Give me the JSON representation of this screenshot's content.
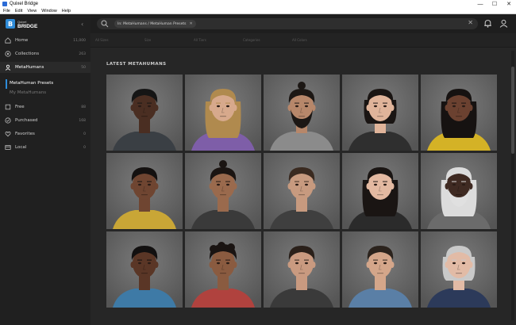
{
  "window": {
    "title": "Quixel Bridge",
    "menu": [
      "File",
      "Edit",
      "View",
      "Window",
      "Help"
    ]
  },
  "sidebar": {
    "logo_top": "Quixel",
    "logo_bottom": "BRIDGE",
    "items": [
      {
        "label": "Home",
        "count": "11,000",
        "icon": "home-icon"
      },
      {
        "label": "Collections",
        "count": "263",
        "icon": "collections-icon"
      },
      {
        "label": "MetaHumans",
        "count": "50",
        "icon": "metahumans-icon"
      },
      {
        "label": "Free",
        "count": "88",
        "icon": "free-icon"
      },
      {
        "label": "Purchased",
        "count": "168",
        "icon": "purchased-icon"
      },
      {
        "label": "Favorites",
        "count": "0",
        "icon": "favorites-icon"
      },
      {
        "label": "Local",
        "count": "0",
        "icon": "local-icon"
      }
    ],
    "sub_items": [
      "MetaHuman Presets",
      "My MetaHumans"
    ]
  },
  "search": {
    "chip": "In: MetaHumans / MetaHuman Presets"
  },
  "filters": [
    "All Sizes",
    "Size",
    "All Tiers",
    "Categories",
    "All Colors"
  ],
  "section_title": "LATEST METAHUMANS",
  "metahumans": [
    {
      "skin": "#4a2e22",
      "hair": "#151515",
      "shirt": "#3a3f44",
      "hairStyle": "short"
    },
    {
      "skin": "#d7a98c",
      "hair": "#b08a4e",
      "shirt": "#7e5ea8",
      "hairStyle": "long"
    },
    {
      "skin": "#b7876a",
      "hair": "#1c1714",
      "shirt": "#8b8b8b",
      "hairStyle": "bun",
      "beard": true
    },
    {
      "skin": "#e0b49a",
      "hair": "#1a1513",
      "shirt": "#2f2f2f",
      "hairStyle": "bob"
    },
    {
      "skin": "#6b4130",
      "hair": "#161211",
      "shirt": "#d4b226",
      "hairStyle": "long"
    },
    {
      "skin": "#6f4531",
      "hair": "#141110",
      "shirt": "#c9a636",
      "hairStyle": "short"
    },
    {
      "skin": "#9a6a4d",
      "hair": "#1b1512",
      "shirt": "#3a3a3a",
      "hairStyle": "bun"
    },
    {
      "skin": "#c79a7f",
      "hair": "#3a2a20",
      "shirt": "#3f3f3f",
      "hairStyle": "short"
    },
    {
      "skin": "#e3b9a1",
      "hair": "#1a1513",
      "shirt": "#2b2b2b",
      "hairStyle": "long"
    },
    {
      "skin": "#3f2a22",
      "hair": "#dcdcdc",
      "shirt": "#6b6b6b",
      "hairStyle": "long",
      "beard": true,
      "beardColor": "#e0e0e0"
    },
    {
      "skin": "#5a3626",
      "hair": "#121010",
      "shirt": "#3e7aa6",
      "hairStyle": "short"
    },
    {
      "skin": "#8a5b40",
      "hair": "#1a1412",
      "shirt": "#b0423e",
      "hairStyle": "curly"
    },
    {
      "skin": "#c99a80",
      "hair": "#2a201a",
      "shirt": "#3a3a3a",
      "hairStyle": "short"
    },
    {
      "skin": "#d4a68a",
      "hair": "#2b231d",
      "shirt": "#5a7fa6",
      "hairStyle": "short"
    },
    {
      "skin": "#e2bba6",
      "hair": "#c9c9c9",
      "shirt": "#2c3a5a",
      "hairStyle": "bob"
    }
  ]
}
